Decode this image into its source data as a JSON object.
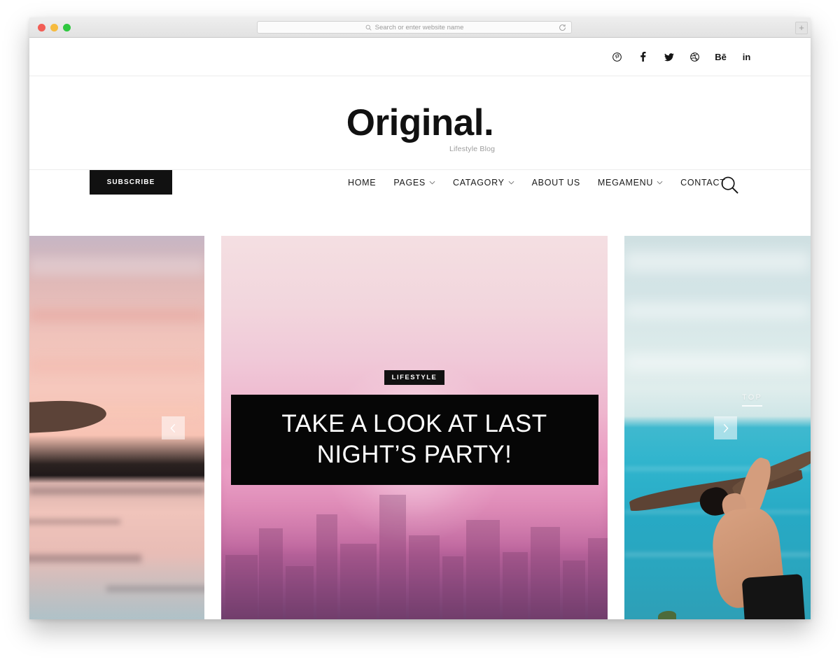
{
  "browser": {
    "address_placeholder": "Search or enter website name",
    "search_icon": "search-icon",
    "reload_icon": "reload-icon",
    "new_tab_label": "+",
    "traffic_lights": [
      "close",
      "minimize",
      "maximize"
    ]
  },
  "site": {
    "logo_title": "Original.",
    "logo_tagline": "Lifestyle Blog"
  },
  "social": [
    {
      "name": "pinterest",
      "label": "P"
    },
    {
      "name": "facebook",
      "label": "f"
    },
    {
      "name": "twitter",
      "label": "t"
    },
    {
      "name": "dribbble",
      "label": "d"
    },
    {
      "name": "behance",
      "label": "Bē"
    },
    {
      "name": "linkedin",
      "label": "in"
    }
  ],
  "nav": {
    "subscribe_label": "SUBSCRIBE",
    "items": [
      {
        "label": "HOME",
        "has_dropdown": false
      },
      {
        "label": "PAGES",
        "has_dropdown": true
      },
      {
        "label": "CATAGORY",
        "has_dropdown": true
      },
      {
        "label": "ABOUT US",
        "has_dropdown": false
      },
      {
        "label": "MEGAMENU",
        "has_dropdown": true
      },
      {
        "label": "CONTACT",
        "has_dropdown": false
      }
    ],
    "search_icon": "search-icon"
  },
  "slider": {
    "prev_label": "‹",
    "next_label": "›",
    "slides": [
      {
        "position": "left",
        "artwork": "pink sunset over water with surfboard silhouette",
        "category": "",
        "title": ""
      },
      {
        "position": "center",
        "artwork": "pink hazy city skyline at sunrise",
        "category": "LIFESTYLE",
        "title": "TAKE A LOOK AT LAST NIGHT’S PARTY!"
      },
      {
        "position": "right",
        "artwork": "man lifting driftwood over turquoise ocean",
        "category": "TOP",
        "title": ""
      }
    ]
  },
  "colors": {
    "accent_dark": "#111111",
    "text": "#1a1a1a",
    "muted": "#9d9d9d",
    "chrome": "#e8e8e8"
  }
}
